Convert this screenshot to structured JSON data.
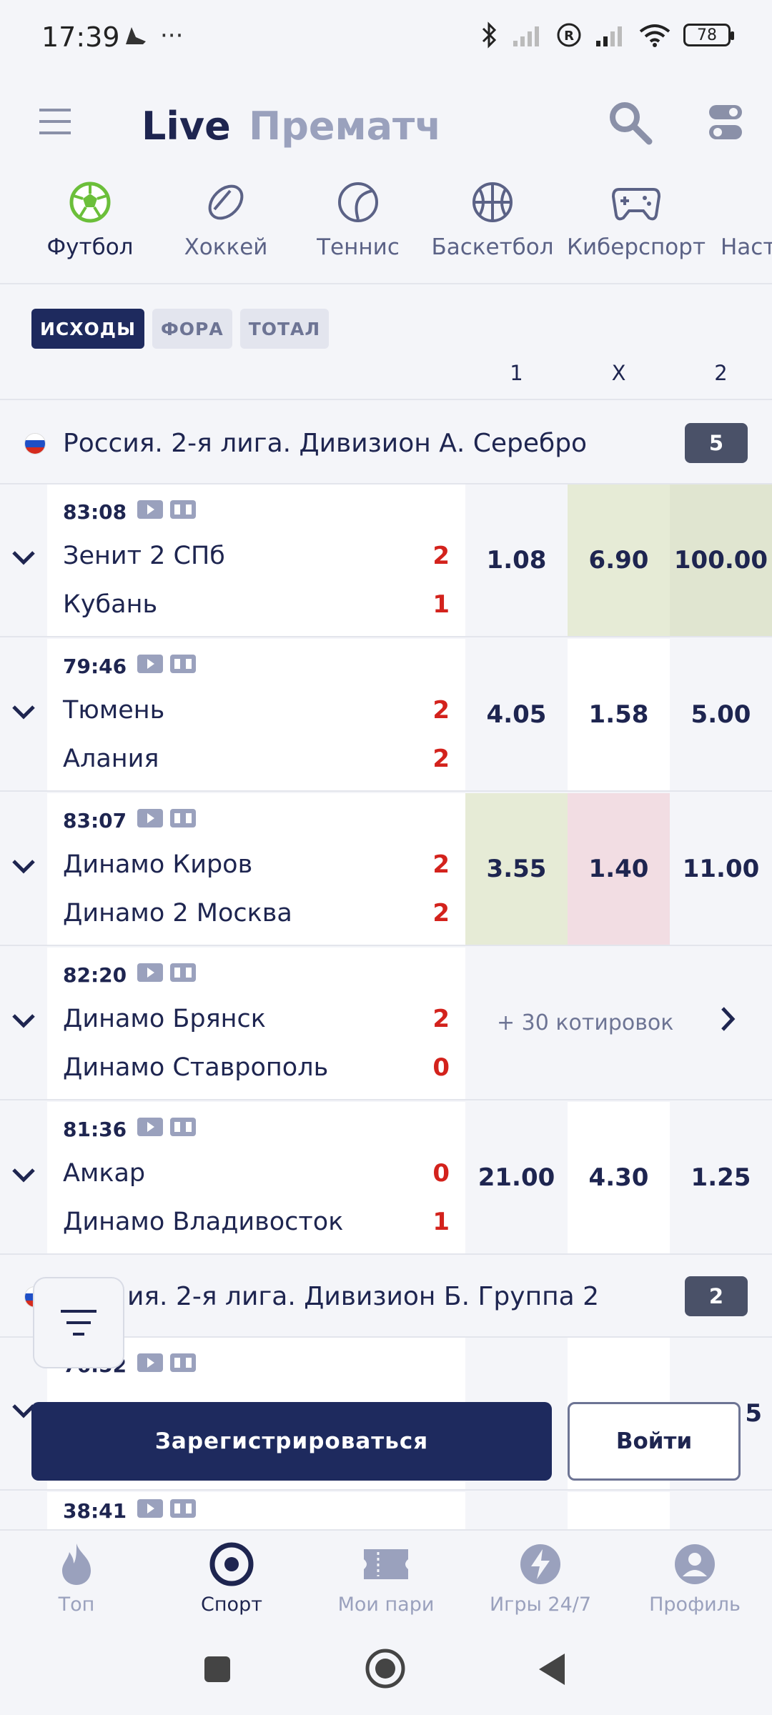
{
  "status_bar": {
    "time": "17:39",
    "battery": "78"
  },
  "header": {
    "live_label": "Live",
    "prematch_label": "Прематч"
  },
  "sports": [
    {
      "label": "Футбол",
      "icon": "soccer-ball-icon",
      "active": true
    },
    {
      "label": "Хоккей",
      "icon": "hockey-puck-icon"
    },
    {
      "label": "Теннис",
      "icon": "tennis-ball-icon"
    },
    {
      "label": "Баскетбол",
      "icon": "basketball-icon"
    },
    {
      "label": "Киберспорт",
      "icon": "gamepad-icon"
    },
    {
      "label": "Наст"
    }
  ],
  "filters": [
    "ИСХОДЫ",
    "ФОРА",
    "ТОТАЛ"
  ],
  "columns": [
    "1",
    "X",
    "2"
  ],
  "leagues": [
    {
      "name": "Россия. 2-я лига. Дивизион А. Серебро",
      "count": "5"
    },
    {
      "name": "ия. 2-я лига. Дивизион Б. Группа 2",
      "count": "2"
    }
  ],
  "matches": [
    {
      "time": "83:08",
      "team1": "Зенит 2 СПб",
      "team2": "Кубань",
      "score1": "2",
      "score2": "1",
      "odds": [
        "1.08",
        "6.90",
        "100.00"
      ]
    },
    {
      "time": "79:46",
      "team1": "Тюмень",
      "team2": "Алания",
      "score1": "2",
      "score2": "2",
      "odds": [
        "4.05",
        "1.58",
        "5.00"
      ]
    },
    {
      "time": "83:07",
      "team1": "Динамо Киров",
      "team2": "Динамо 2 Москва",
      "score1": "2",
      "score2": "2",
      "odds": [
        "3.55",
        "1.40",
        "11.00"
      ]
    },
    {
      "time": "82:20",
      "team1": "Динамо Брянск",
      "team2": "Динамо Ставрополь",
      "score1": "2",
      "score2": "0",
      "more": "+ 30 котировок"
    },
    {
      "time": "81:36",
      "team1": "Амкар",
      "team2": "Динамо Владивосток",
      "score1": "0",
      "score2": "1",
      "odds": [
        "21.00",
        "4.30",
        "1.25"
      ]
    },
    {
      "time": "76:52",
      "odd3_partial": "5"
    },
    {
      "time": "38:41"
    }
  ],
  "colors": {
    "accent": "#1e2a5e",
    "score": "#d3221c",
    "odd_up": "#e6ebd6",
    "odd_up_strong": "#e0e5d0",
    "odd_down": "#f2dde3"
  },
  "buttons": {
    "register": "Зарегистрироваться",
    "login": "Войти"
  },
  "bottom_nav": [
    {
      "label": "Топ",
      "icon": "flame-icon"
    },
    {
      "label": "Спорт",
      "icon": "sport-target-icon",
      "active": true
    },
    {
      "label": "Мои пари",
      "icon": "ticket-icon"
    },
    {
      "label": "Игры 24/7",
      "icon": "lightning-icon"
    },
    {
      "label": "Профиль",
      "icon": "profile-icon"
    }
  ]
}
